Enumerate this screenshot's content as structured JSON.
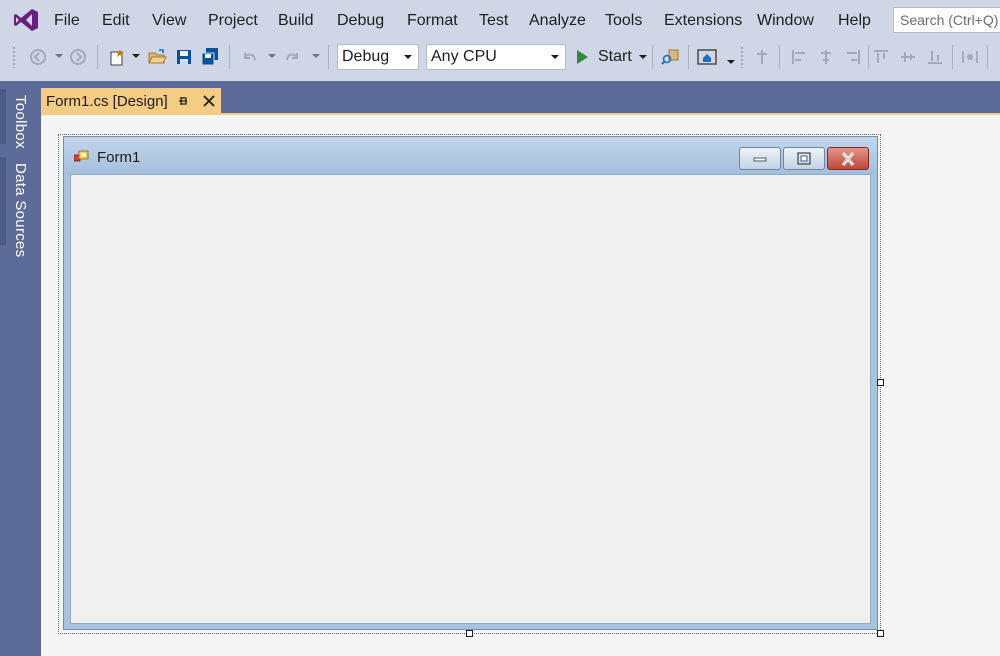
{
  "app": {
    "logo_icon": "visual-studio-logo-icon",
    "accent_color": "#68217a"
  },
  "menu": {
    "items": [
      {
        "label": "File"
      },
      {
        "label": "Edit"
      },
      {
        "label": "View"
      },
      {
        "label": "Project"
      },
      {
        "label": "Build"
      },
      {
        "label": "Debug"
      },
      {
        "label": "Format"
      },
      {
        "label": "Test"
      },
      {
        "label": "Analyze"
      },
      {
        "label": "Tools"
      },
      {
        "label": "Extensions"
      },
      {
        "label": "Window"
      },
      {
        "label": "Help"
      }
    ],
    "search_placeholder": "Search (Ctrl+Q)"
  },
  "toolbar": {
    "configuration": "Debug",
    "platform": "Any CPU",
    "start_label": "Start",
    "start_color": "#2f8b3a",
    "icons": [
      "navigate-back-icon",
      "navigate-forward-icon",
      "new-project-icon",
      "open-file-icon",
      "save-icon",
      "save-all-icon",
      "undo-icon",
      "redo-icon",
      "find-in-files-icon",
      "home-icon",
      "align-lefts-icon",
      "align-centers-icon",
      "align-rights-icon",
      "align-tops-icon",
      "align-middles-icon",
      "align-bottoms-icon",
      "equal-spacing-icon"
    ]
  },
  "side_panel": {
    "tabs": [
      {
        "label": "Toolbox"
      },
      {
        "label": "Data Sources"
      }
    ]
  },
  "document": {
    "tab_title": "Form1.cs [Design]",
    "tab_color": "#f5cc84"
  },
  "designer": {
    "form_title": "Form1",
    "background": "#f0f0f0"
  }
}
